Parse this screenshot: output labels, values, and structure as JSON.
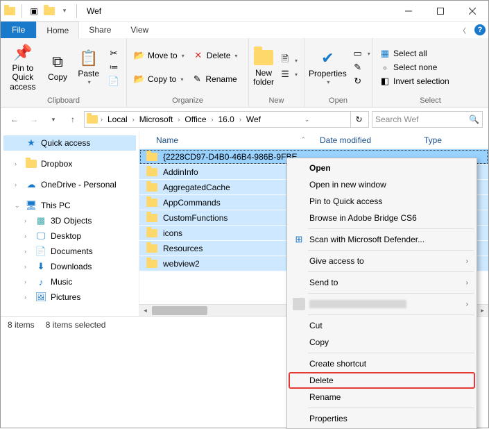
{
  "window": {
    "title": "Wef"
  },
  "tabs": {
    "file": "File",
    "home": "Home",
    "share": "Share",
    "view": "View"
  },
  "ribbon": {
    "clipboard": {
      "label": "Clipboard",
      "pin": "Pin to Quick access",
      "copy": "Copy",
      "paste": "Paste"
    },
    "organize": {
      "label": "Organize",
      "moveto": "Move to",
      "copyto": "Copy to",
      "delete": "Delete",
      "rename": "Rename"
    },
    "new": {
      "label": "New",
      "newfolder": "New folder"
    },
    "open": {
      "label": "Open",
      "properties": "Properties"
    },
    "select": {
      "label": "Select",
      "selectall": "Select all",
      "selectnone": "Select none",
      "invert": "Invert selection"
    }
  },
  "breadcrumbs": [
    "Local",
    "Microsoft",
    "Office",
    "16.0",
    "Wef"
  ],
  "search_placeholder": "Search Wef",
  "tree": {
    "quickaccess": "Quick access",
    "dropbox": "Dropbox",
    "onedrive": "OneDrive - Personal",
    "thispc": "This PC",
    "objects3d": "3D Objects",
    "desktop": "Desktop",
    "documents": "Documents",
    "downloads": "Downloads",
    "music": "Music",
    "pictures": "Pictures"
  },
  "columns": {
    "name": "Name",
    "date": "Date modified",
    "type": "Type"
  },
  "rows": [
    "{2228CD97-D4B0-46B4-986B-9FBE",
    "AddinInfo",
    "AggregatedCache",
    "AppCommands",
    "CustomFunctions",
    "icons",
    "Resources",
    "webview2"
  ],
  "status": {
    "items": "8 items",
    "selected": "8 items selected"
  },
  "context": {
    "open": "Open",
    "opennew": "Open in new window",
    "pinqa": "Pin to Quick access",
    "bridge": "Browse in Adobe Bridge CS6",
    "defender": "Scan with Microsoft Defender...",
    "giveaccess": "Give access to",
    "sendto": "Send to",
    "cut": "Cut",
    "copy": "Copy",
    "shortcut": "Create shortcut",
    "delete": "Delete",
    "rename": "Rename",
    "properties": "Properties"
  }
}
